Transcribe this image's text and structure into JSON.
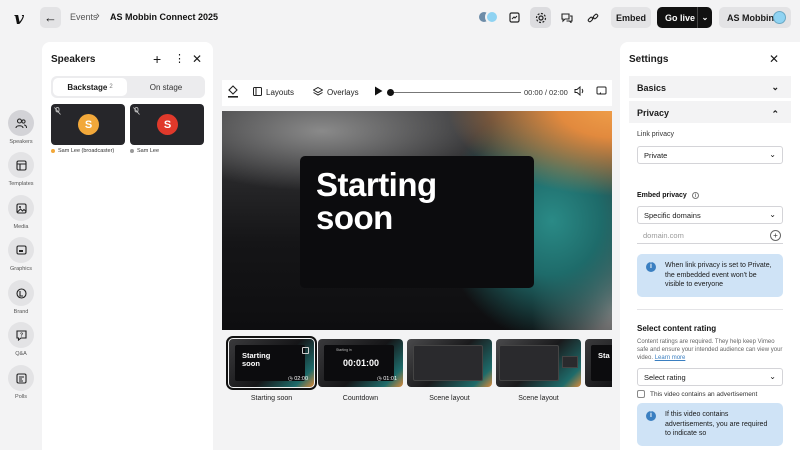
{
  "app": {
    "logo": "v",
    "breadcrumb_parent": "Events",
    "breadcrumb_sep": "›",
    "event_title": "AS Mobbin Connect 2025",
    "embed_label": "Embed",
    "golive_label": "Go live",
    "account_name": "AS Mobbin"
  },
  "rail": [
    {
      "label": "Speakers",
      "icon": "people-icon"
    },
    {
      "label": "Templates",
      "icon": "templates-icon"
    },
    {
      "label": "Media",
      "icon": "image-icon"
    },
    {
      "label": "Graphics",
      "icon": "graphics-icon"
    },
    {
      "label": "Brand",
      "icon": "brand-icon"
    },
    {
      "label": "Q&A",
      "icon": "qa-icon"
    },
    {
      "label": "Polls",
      "icon": "polls-icon"
    }
  ],
  "speakers": {
    "title": "Speakers",
    "tab_backstage": "Backstage",
    "tab_backstage_count": "2",
    "tab_onstage": "On stage",
    "tiles": [
      {
        "initial": "S",
        "name": "Sam Lee (broadcaster)",
        "color": "#f2a83a",
        "dot": "#f2a83a"
      },
      {
        "initial": "S",
        "name": "Sam Lee",
        "color": "#e0392b",
        "dot": "#9a9a9a"
      }
    ]
  },
  "stage_toolbar": {
    "layouts": "Layouts",
    "overlays": "Overlays",
    "timecode": "00:00 / 02:00"
  },
  "stage": {
    "title_line1": "Starting",
    "title_line2": "soon"
  },
  "scenes": [
    {
      "label": "Starting soon",
      "thumb_text": "Starting soon",
      "time": "02:00"
    },
    {
      "label": "Countdown",
      "thumb_text": "00:01:00",
      "small": "Starting in",
      "time": "01:01"
    },
    {
      "label": "Scene layout"
    },
    {
      "label": "Scene layout"
    },
    {
      "label": "",
      "thumb_text": "Sta"
    }
  ],
  "settings": {
    "title": "Settings",
    "basics": "Basics",
    "privacy": "Privacy",
    "link_privacy_label": "Link privacy",
    "link_privacy_value": "Private",
    "embed_privacy_label": "Embed privacy",
    "embed_privacy_value": "Specific domains",
    "domain_placeholder": "domain.com",
    "info_private": "When link privacy is set to Private, the embedded event won't be visible to everyone",
    "content_rating_title": "Select content rating",
    "content_rating_help": "Content ratings are required. They help keep Vimeo safe and ensure your intended audience can view your video.",
    "learn_more": "Learn more",
    "rating_placeholder": "Select rating",
    "ad_checkbox": "This video contains an advertisement",
    "info_ads": "If this video contains advertisements, you are required to indicate so"
  }
}
